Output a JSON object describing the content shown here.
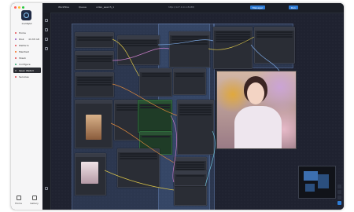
{
  "app": {
    "name": "ComfyUI"
  },
  "sidebar": {
    "items": [
      {
        "label": "Home",
        "value": "",
        "color": "#e5484d"
      },
      {
        "label": "Disk",
        "value": "49.88 GB",
        "color": "#8e4ec6"
      },
      {
        "label": "Platform",
        "value": "",
        "color": "#e5484d"
      },
      {
        "label": "Manifest",
        "value": "",
        "color": "#f76b15"
      },
      {
        "label": "Shack",
        "value": "",
        "color": "#e5484d"
      },
      {
        "label": "Configure",
        "value": "",
        "color": "#30a46c"
      },
      {
        "label": "Open WebUI",
        "value": "",
        "color": "#888888",
        "active": true
      },
      {
        "label": "Services",
        "value": "",
        "color": "#e5484d"
      }
    ],
    "bottom": [
      {
        "label": "Home",
        "icon": "home-icon"
      },
      {
        "label": "Gallery",
        "icon": "gallery-icon"
      }
    ]
  },
  "topbar": {
    "workflow": "Workflow",
    "queue": "Queue",
    "tab_title": "video_search_1",
    "address": "http://127.0.0.1:8188/",
    "manager_label": "Manager",
    "run_label": "Run"
  },
  "colors": {
    "accent": "#2e7cd6",
    "green": "#2a5234"
  }
}
